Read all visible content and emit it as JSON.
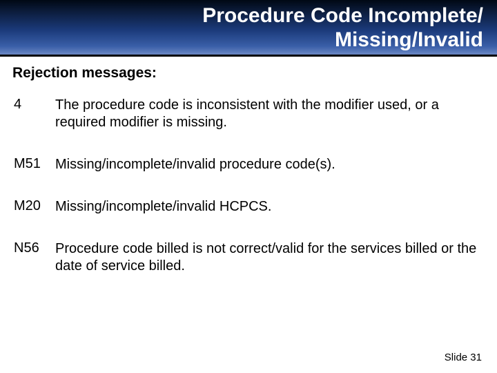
{
  "title_line1": "Procedure Code Incomplete/",
  "title_line2": "Missing/Invalid",
  "subheading": "Rejection messages:",
  "rows": [
    {
      "code": "4",
      "desc": "The procedure code is inconsistent with the modifier used, or a required modifier is missing."
    },
    {
      "code": "M51",
      "desc": "Missing/incomplete/invalid procedure code(s)."
    },
    {
      "code": "M20",
      "desc": "Missing/incomplete/invalid HCPCS."
    },
    {
      "code": "N56",
      "desc": "Procedure code billed is not correct/valid for the services billed or the date of service billed."
    }
  ],
  "footer": "Slide 31"
}
